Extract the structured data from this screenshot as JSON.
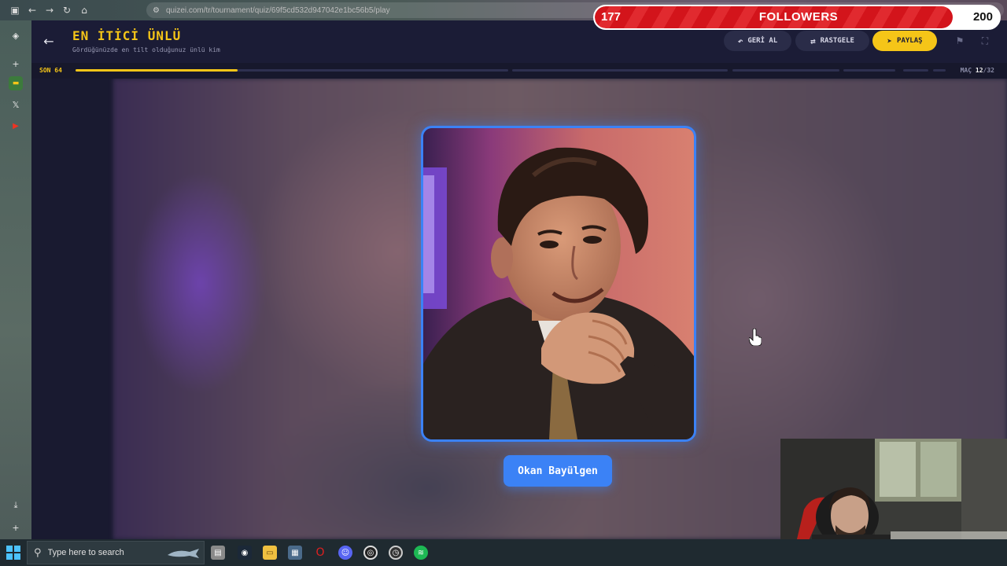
{
  "browser": {
    "url": "quizei.com/tr/tournament/quiz/69f5cd532d947042e1bc56b5/play",
    "nav_icons": [
      "sidebar-toggle-icon",
      "back-icon",
      "forward-icon",
      "reload-icon",
      "home-icon"
    ]
  },
  "sidebar": {
    "icons": [
      "extension-icon",
      "add-icon",
      "yellow-app-icon",
      "x-icon",
      "youtube-icon",
      "download-icon",
      "plus-icon"
    ]
  },
  "quiz": {
    "title": "EN İTİCİ ÜNLÜ",
    "subtitle": "Gördüğünüzde en tilt olduğunuz ünlü kim",
    "buttons": {
      "undo": "GERİ AL",
      "random": "RASTGELE",
      "share": "PAYLAŞ"
    },
    "round_label": "SON 64",
    "match_prefix": "MAÇ",
    "match_current": "12",
    "match_separator": "/",
    "match_total": "32",
    "progress_fraction": 0.375,
    "contestant_name": "Okan Bayülgen",
    "accent_color": "#f5c518",
    "card_color": "#3b82f6"
  },
  "followers": {
    "current": "177",
    "label": "FOLLOWERS",
    "goal": "200",
    "progress_fraction": 0.885,
    "bar_color": "#d3141b"
  },
  "taskbar": {
    "search_placeholder": "Type here to search",
    "apps": [
      "task-view-icon",
      "steam-icon",
      "file-explorer-icon",
      "calculator-icon",
      "opera-icon",
      "discord-icon",
      "obs-icon",
      "clock-app-icon",
      "spotify-icon"
    ]
  }
}
